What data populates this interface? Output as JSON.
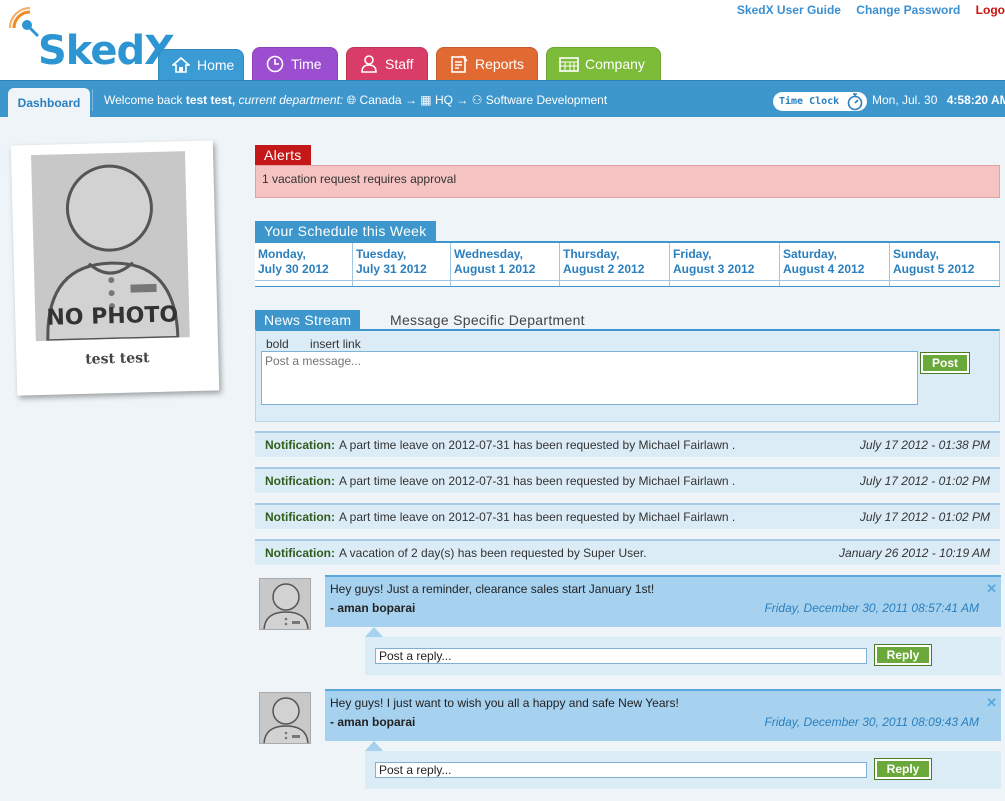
{
  "header": {
    "logo_text": "SkedX",
    "links": {
      "guide": "SkedX User Guide",
      "password": "Change Password",
      "logout": "Logo"
    },
    "tabs": [
      {
        "label": "Home",
        "icon": "home-icon",
        "color": "#3a9bd5"
      },
      {
        "label": "Time",
        "icon": "clock-icon",
        "color": "#9c4ed0"
      },
      {
        "label": "Staff",
        "icon": "person-icon",
        "color": "#d93c66"
      },
      {
        "label": "Reports",
        "icon": "report-icon",
        "color": "#e06a32"
      },
      {
        "label": "Company",
        "icon": "calendar-icon",
        "color": "#7cbc38"
      }
    ]
  },
  "bar": {
    "dashboard": "Dashboard",
    "welcome_prefix": "Welcome back",
    "username": "test test,",
    "dept_label": "current department:",
    "dept_path": [
      "Canada",
      "HQ",
      "Software Development"
    ],
    "arrow": "→",
    "time_clock": "Time Clock",
    "date": "Mon, Jul. 30",
    "time": "4:58:20 AM"
  },
  "profile": {
    "photo_label": "NO PHOTO",
    "name": "test test"
  },
  "alerts": {
    "title": "Alerts",
    "message": "1 vacation request requires approval"
  },
  "schedule": {
    "title": "Your Schedule this Week",
    "days": [
      {
        "name": "Monday,",
        "date": "July 30 2012"
      },
      {
        "name": "Tuesday,",
        "date": "July 31 2012"
      },
      {
        "name": "Wednesday,",
        "date": "August 1 2012"
      },
      {
        "name": "Thursday,",
        "date": "August 2 2012"
      },
      {
        "name": "Friday,",
        "date": "August 3 2012"
      },
      {
        "name": "Saturday,",
        "date": "August 4 2012"
      },
      {
        "name": "Sunday,",
        "date": "August 5 2012"
      }
    ]
  },
  "news": {
    "tab_active": "News Stream",
    "tab_other": "Message Specific Department",
    "tools": {
      "bold": "bold",
      "link": "insert link"
    },
    "placeholder": "Post a message...",
    "post_button": "Post"
  },
  "notifications": [
    {
      "label": "Notification:",
      "text": "A part time leave on 2012-07-31 has been requested by Michael Fairlawn .",
      "date": "July 17 2012 - 01:38 PM"
    },
    {
      "label": "Notification:",
      "text": "A part time leave on 2012-07-31 has been requested by Michael Fairlawn .",
      "date": "July 17 2012 - 01:02 PM"
    },
    {
      "label": "Notification:",
      "text": "A part time leave on 2012-07-31 has been requested by Michael Fairlawn .",
      "date": "July 17 2012 - 01:02 PM"
    },
    {
      "label": "Notification:",
      "text": "A vacation of 2 day(s) has been requested by Super User.",
      "date": "January 26 2012 - 10:19 AM"
    }
  ],
  "posts": [
    {
      "message": "Hey guys! Just a reminder, clearance sales start January 1st!",
      "author": "- aman boparai",
      "date": "Friday, December 30, 2011 08:57:41 AM",
      "reply_value": "Post a reply...",
      "reply_button": "Reply"
    },
    {
      "message": "Hey guys! I just want to wish you all a happy and safe New Years!",
      "author": "- aman boparai",
      "date": "Friday, December 30, 2011 08:09:43 AM",
      "reply_value": "Post a reply...",
      "reply_button": "Reply"
    }
  ]
}
